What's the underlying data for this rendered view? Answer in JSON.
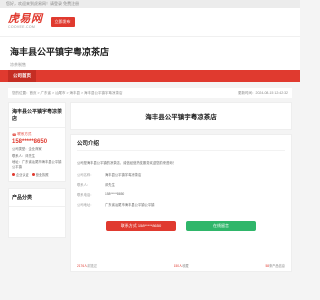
{
  "topbar": {
    "text": "您好，欢迎来到虎易网！请登录 免费注册"
  },
  "header": {
    "logo": "虎易网",
    "logo_sub": "COOVEE.COM",
    "publish_label": "立即发布"
  },
  "company": {
    "name": "海丰县公平镇宇粤凉茶店",
    "tag": "凉茶制售"
  },
  "nav": {
    "items": [
      "公司首页"
    ]
  },
  "breadcrumb": {
    "path": "您的位置：首页 > 广东省 > 汕尾市 > 海丰县 > 海丰县公平镇宇粤凉茶店",
    "updated": "更新时间：2024-08-15 12:42:32"
  },
  "sidebar": {
    "title": "海丰县公平镇宇粤凉茶店",
    "contact_label": "联系方式",
    "phone": "158*****8650",
    "info": [
      "公司类型：企业商家",
      "联系人：邓先生",
      "地址：广东省汕尾市海丰县公平镇公平镇"
    ],
    "badges": [
      "企业认证",
      "营业执照"
    ],
    "products_title": "产品分类"
  },
  "main": {
    "title": "海丰县公平镇宇粤凉茶店",
    "intro_heading": "公司介绍",
    "intro_text": "公司是海丰县公平镇的凉茶店，诚信经营热忱服务欢迎您前来咨询！",
    "details": [
      {
        "key": "公司名称：",
        "value": "海丰县公平镇宇粤凉茶店"
      },
      {
        "key": "联系人：",
        "value": "邓先生"
      },
      {
        "key": "联系电话：",
        "value": "158*****8650"
      },
      {
        "key": "公司地址：",
        "value": "广东省汕尾市海丰县公平镇公平镇"
      }
    ],
    "phone_button": "联系方式 158*****8650",
    "mail_button": "在线留言",
    "stats": [
      {
        "value": "2176人",
        "label": "浏览过"
      },
      {
        "value": "150人",
        "label": "收藏"
      },
      {
        "value": "58",
        "label": "条产品信息"
      }
    ]
  },
  "colors": {
    "brand": "#e03a2f",
    "green": "#2fb66a"
  }
}
